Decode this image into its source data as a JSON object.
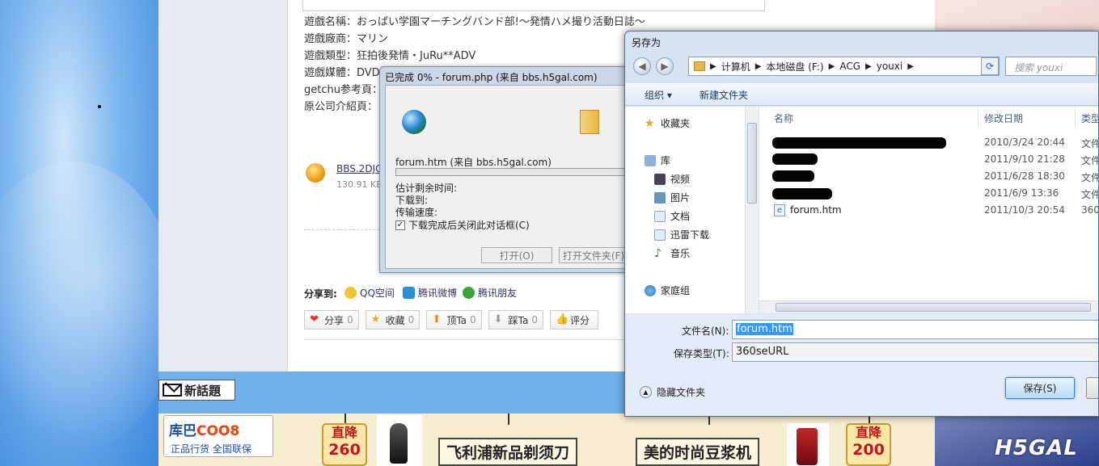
{
  "forum": {
    "game_info": [
      "遊戲名稱：おっぱい学園マーチングバンド部!～発情ハメ撮り活動日誌～",
      "遊戲廠商：マリン",
      "遊戲類型：狂拍後発情・JuRu**ADV",
      "遊戲媒體：DVD",
      "getchu参考頁：",
      "原公司介紹頁："
    ],
    "attachment_name": "BBS.2DJG",
    "attachment_size": "130.91 KB",
    "share_label": "分享到:",
    "share_items": [
      "QQ空间",
      "腾讯微博",
      "腾讯朋友"
    ],
    "action_buttons": [
      {
        "label": "分享",
        "count": "0"
      },
      {
        "label": "收藏",
        "count": "0"
      },
      {
        "label": "顶Ta",
        "count": "0"
      },
      {
        "label": "踩Ta",
        "count": "0"
      },
      {
        "label": "评分",
        "count": ""
      }
    ],
    "new_topic": "新話題"
  },
  "ads": {
    "kuba_logo": "库巴",
    "kuba_logo_b": "COO8",
    "kuba_slogan": "正品行货  全国联保",
    "price_left_a": "直降",
    "price_left_b": "260",
    "tag_left": "飞利浦新品剃须刀",
    "tag_right": "美的时尚豆浆机",
    "price_right_a": "直降",
    "price_right_b": "200",
    "site_logo": "H5GAL"
  },
  "download_dialog": {
    "title": "已完成 0% - forum.php (来自 bbs.h5gal.com)",
    "file_line": "forum.htm (来自 bbs.h5gal.com)",
    "progress_percent": 0,
    "remaining_label": "估计剩余时间:",
    "download_to_label": "下载到:",
    "speed_label": "传输速度:",
    "close_when_done": "下载完成后关闭此对话框(C)",
    "open_button": "打开(O)",
    "open_folder_button": "打开文件夹(F)"
  },
  "save_dialog": {
    "title": "另存为",
    "breadcrumb": [
      "计算机",
      "本地磁盘 (F:)",
      "ACG",
      "youxi"
    ],
    "search_placeholder": "搜索 youxi",
    "organize": "组织 ▾",
    "new_folder": "新建文件夹",
    "nav": {
      "favorites": "收藏夹",
      "libraries": "库",
      "videos": "视频",
      "pictures": "图片",
      "documents": "文档",
      "thunder": "迅雷下载",
      "music": "音乐",
      "homegroup": "家庭组"
    },
    "columns": {
      "name": "名称",
      "date": "修改日期",
      "type": "类型"
    },
    "files": [
      {
        "name": "",
        "date": "2010/3/24 20:44",
        "type": "文件"
      },
      {
        "name": "",
        "date": "2011/9/10 21:28",
        "type": "文件"
      },
      {
        "name": "",
        "date": "2011/6/28 18:30",
        "type": "文件"
      },
      {
        "name": "",
        "date": "2011/6/9 13:36",
        "type": "文件"
      },
      {
        "name": "forum.htm",
        "date": "2011/10/3 20:54",
        "type": "360"
      }
    ],
    "filename_label": "文件名(N):",
    "filename_value": "forum.htm",
    "filetype_label": "保存类型(T):",
    "filetype_value": "360seURL",
    "hide_folders": "隐藏文件夹",
    "save_button": "保存(S)"
  }
}
